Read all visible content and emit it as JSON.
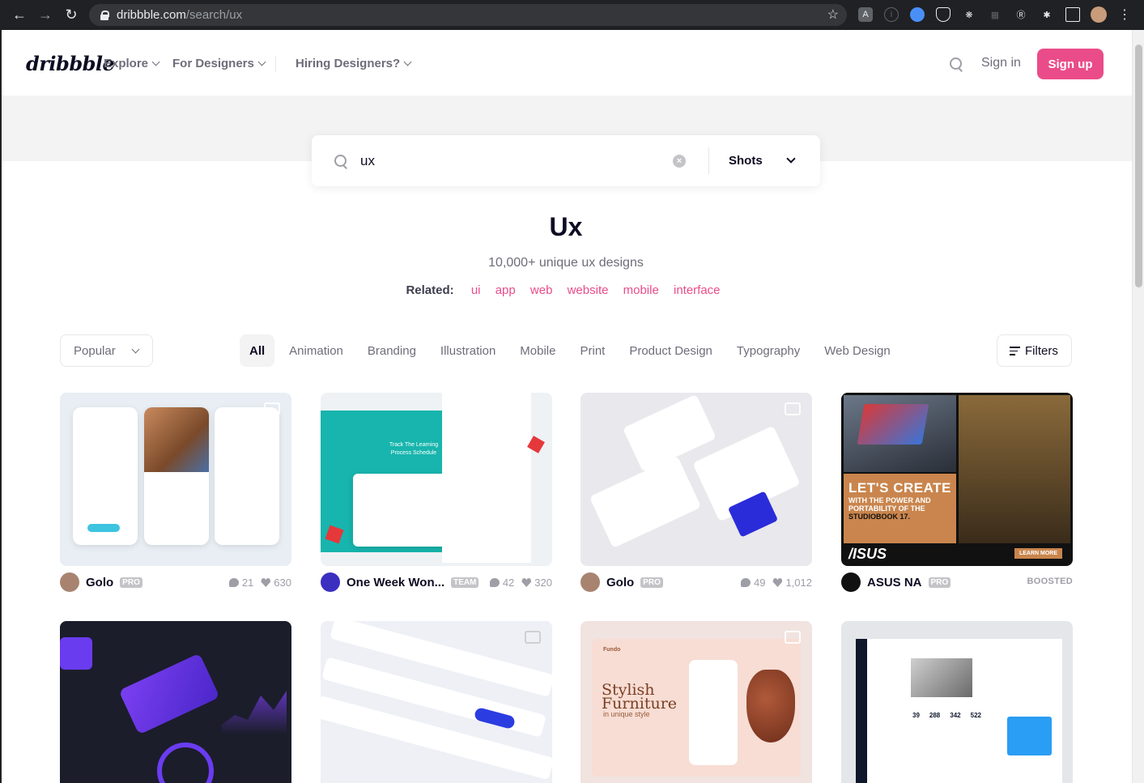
{
  "browser": {
    "url_host": "dribbble.com",
    "url_path": "/search/ux"
  },
  "header": {
    "logo": "dribbble",
    "nav": [
      {
        "label": "Explore"
      },
      {
        "label": "For Designers"
      },
      {
        "label": "Hiring Designers?"
      }
    ],
    "signin_label": "Sign in",
    "signup_label": "Sign up"
  },
  "search": {
    "query": "ux",
    "scope": "Shots"
  },
  "results": {
    "title": "Ux",
    "subtitle": "10,000+ unique ux designs",
    "related_label": "Related:",
    "related": [
      "ui",
      "app",
      "web",
      "website",
      "mobile",
      "interface"
    ]
  },
  "filters": {
    "sort": "Popular",
    "categories": [
      "All",
      "Animation",
      "Branding",
      "Illustration",
      "Mobile",
      "Print",
      "Product Design",
      "Typography",
      "Web Design"
    ],
    "filters_label": "Filters"
  },
  "shots": [
    {
      "author": "Golo",
      "badge": "PRO",
      "comments": "21",
      "likes": "630"
    },
    {
      "author": "One Week Won...",
      "badge": "TEAM",
      "comments": "42",
      "likes": "320"
    },
    {
      "author": "Golo",
      "badge": "PRO",
      "comments": "49",
      "likes": "1,012"
    },
    {
      "author": "ASUS NA",
      "badge": "PRO",
      "boosted": "BOOSTED",
      "ad_line1": "LET'S CREATE",
      "ad_line2": "WITH THE POWER AND",
      "ad_line3": "PORTABILITY OF THE",
      "ad_line4": "STUDIOBOOK 17.",
      "ad_brand": "/ISUS",
      "ad_cta": "LEARN MORE"
    }
  ],
  "shot_texts": {
    "s2_heading": "Track The Learning Process Schedule",
    "s7_brand": "Fundo",
    "s7_heading1": "Stylish",
    "s7_heading2": "Furniture",
    "s7_sub": "in unique style",
    "s8_stats": [
      "39",
      "288",
      "342",
      "522"
    ]
  }
}
